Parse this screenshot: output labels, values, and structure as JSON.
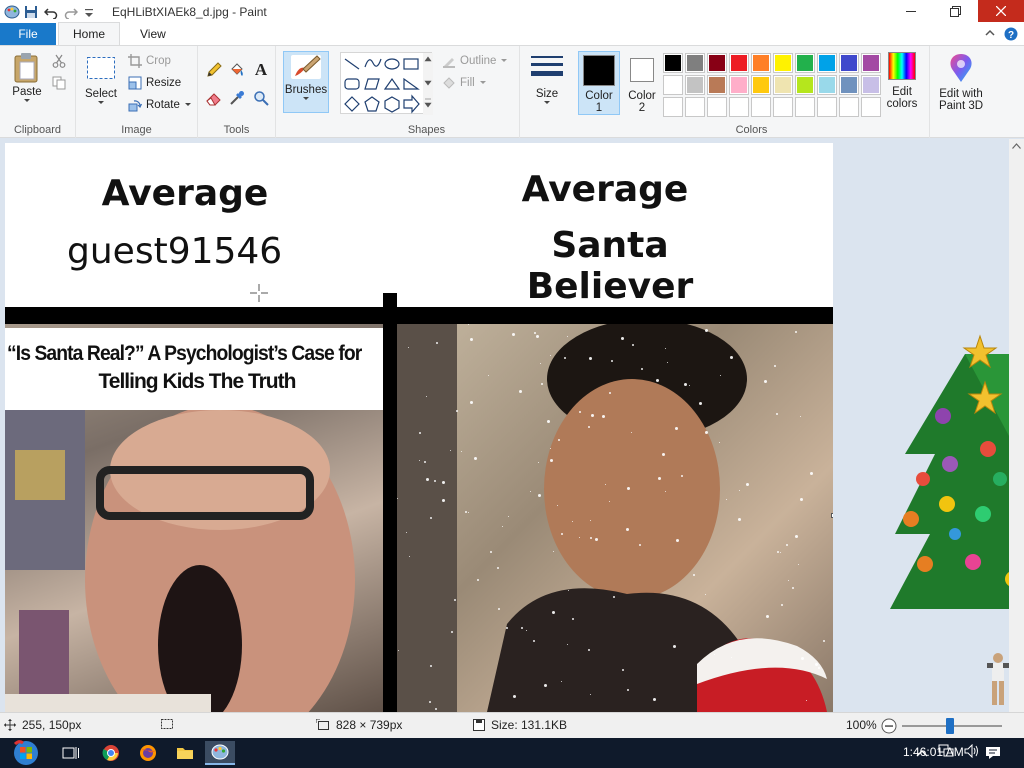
{
  "window": {
    "title": "EqHLiBtXIAEk8_d.jpg - Paint",
    "controls": [
      "minimize",
      "maximize",
      "close"
    ]
  },
  "tabs": [
    {
      "label": "File"
    },
    {
      "label": "Home"
    },
    {
      "label": "View"
    }
  ],
  "ribbon": {
    "clipboard": {
      "label": "Clipboard",
      "paste": "Paste"
    },
    "image": {
      "label": "Image",
      "select": "Select",
      "crop": "Crop",
      "resize": "Resize",
      "rotate": "Rotate"
    },
    "tools": {
      "label": "Tools"
    },
    "brushes": {
      "label": "Brushes"
    },
    "shapes": {
      "label": "Shapes",
      "outline": "Outline",
      "fill": "Fill"
    },
    "size": {
      "label": "Size"
    },
    "colors": {
      "label": "Colors",
      "color1": "Color\n1",
      "color1_a": "Color",
      "color1_b": "1",
      "color2_a": "Color",
      "color2_b": "2",
      "edit_a": "Edit",
      "edit_b": "colors",
      "color1_value": "#000000",
      "color2_value": "#ffffff",
      "palette_row1": [
        "#000000",
        "#7f7f7f",
        "#880015",
        "#ed1c24",
        "#ff7f27",
        "#fff200",
        "#22b14c",
        "#00a2e8",
        "#3f48cc",
        "#a349a4"
      ],
      "palette_row2": [
        "#ffffff",
        "#c3c3c3",
        "#b97a57",
        "#ffaec9",
        "#ffc90e",
        "#efe4b0",
        "#b5e61d",
        "#99d9ea",
        "#7092be",
        "#c8bfe7"
      ],
      "palette_row3": [
        "#ffffff",
        "#ffffff",
        "#ffffff",
        "#ffffff",
        "#ffffff",
        "#ffffff",
        "#ffffff",
        "#ffffff",
        "#ffffff",
        "#ffffff"
      ]
    },
    "paint3d": {
      "label_a": "Edit with",
      "label_b": "Paint 3D"
    }
  },
  "canvas": {
    "left_heading": "Average",
    "left_name": "guest91546",
    "right_heading": "Average",
    "right_name": "Santa Believer",
    "article_title_1": "“Is Santa Real?” A Psychologist’s Case for",
    "article_title_2": "Telling Kids The Truth"
  },
  "status": {
    "cursor": "255, 150px",
    "dimensions": "828 × 739px",
    "size": "Size: 131.1KB",
    "zoom": "100%"
  },
  "taskbar": {
    "clock": "1:46:01 AM"
  }
}
